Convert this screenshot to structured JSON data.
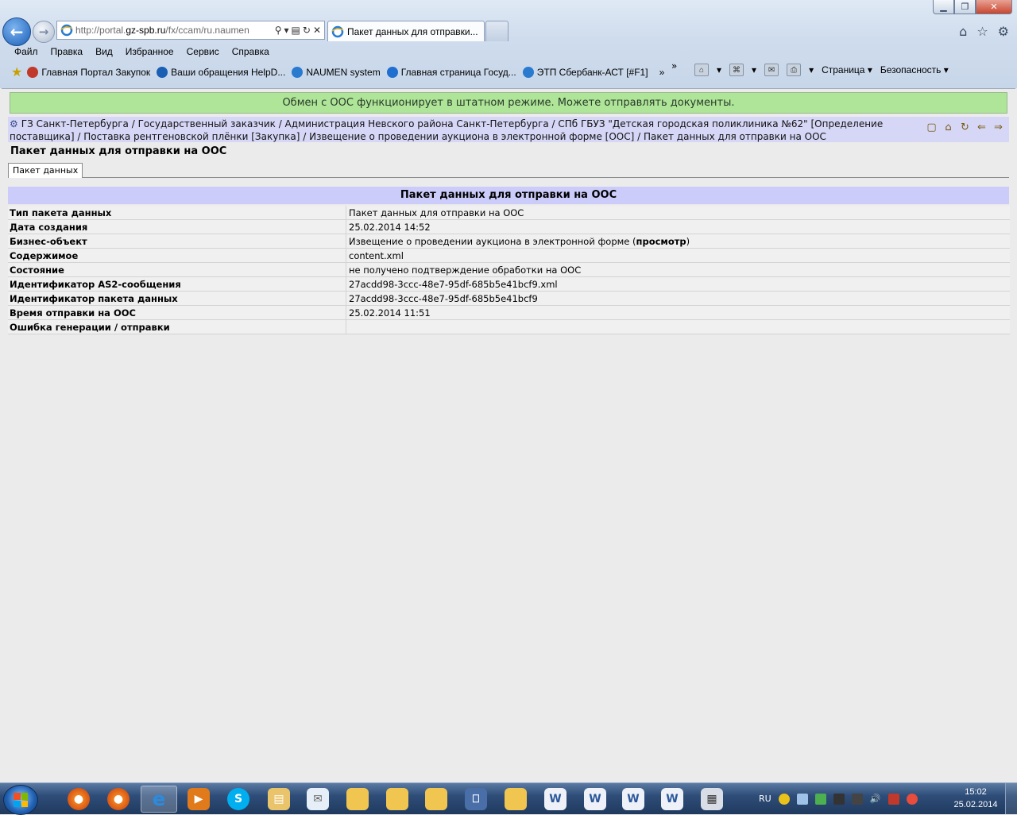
{
  "browser": {
    "url_prefix": "http://portal.",
    "url_domain": "gz-spb.ru",
    "url_rest": "/fx/ccam/ru.naumen",
    "tab_title": "Пакет данных для отправки...",
    "menu": [
      "Файл",
      "Правка",
      "Вид",
      "Избранное",
      "Сервис",
      "Справка"
    ],
    "favorites": [
      {
        "label": "Главная Портал Закупок",
        "color": "#c0392b"
      },
      {
        "label": "Ваши обращения  HelpD...",
        "color": "#1a5fb4"
      },
      {
        "label": "NAUMEN system",
        "color": "#2a7ad0"
      },
      {
        "label": "Главная страница  Госуд...",
        "color": "#1f6fd0"
      },
      {
        "label": "ЭТП Сбербанк-АСТ [#F1]",
        "color": "#2a7ad0"
      }
    ],
    "chevron": "»",
    "command": {
      "page": "Страница",
      "security": "Безопасность"
    }
  },
  "page": {
    "banner": "Обмен с ООС функционирует в штатном режиме. Можете отправлять документы.",
    "breadcrumb": "ГЗ Санкт-Петербурга / Государственный заказчик / Администрация Невского района Санкт-Петербурга / СПб ГБУЗ \"Детская городская поликлиника №62\" [Определение поставщика] / Поставка рентгеновской плёнки [Закупка] / Извещение о проведении аукциона в электронной форме [ООС] / Пакет данных для отправки на ООС",
    "title": "Пакет данных для отправки на ООС",
    "tab": "Пакет данных",
    "section_title": "Пакет данных для отправки на ООС",
    "rows": [
      {
        "label": "Тип пакета данных",
        "value": "Пакет данных для отправки на ООС"
      },
      {
        "label": "Дата создания",
        "value": "25.02.2014 14:52"
      },
      {
        "label": "Бизнес-объект",
        "value": "Извещение о проведении аукциона в электронной форме (",
        "link": "просмотр",
        "suffix": ")"
      },
      {
        "label": "Содержимое",
        "value": "content.xml"
      },
      {
        "label": "Состояние",
        "value": "не получено подтверждение обработки на ООС"
      },
      {
        "label": "Идентификатор AS2-сообщения",
        "value": "27acdd98-3ccc-48e7-95df-685b5e41bcf9.xml"
      },
      {
        "label": "Идентификатор пакета данных",
        "value": "27acdd98-3ccc-48e7-95df-685b5e41bcf9"
      },
      {
        "label": "Время отправки на ООС",
        "value": "25.02.2014 11:51"
      },
      {
        "label": "Ошибка генерации / отправки",
        "value": ""
      }
    ]
  },
  "taskbar": {
    "lang": "RU",
    "time": "15:02",
    "date": "25.02.2014"
  },
  "colors": {
    "banner_bg": "#aee598",
    "breadcrumb_bg": "#d6d7f6",
    "section_bg": "#ccccfb"
  }
}
